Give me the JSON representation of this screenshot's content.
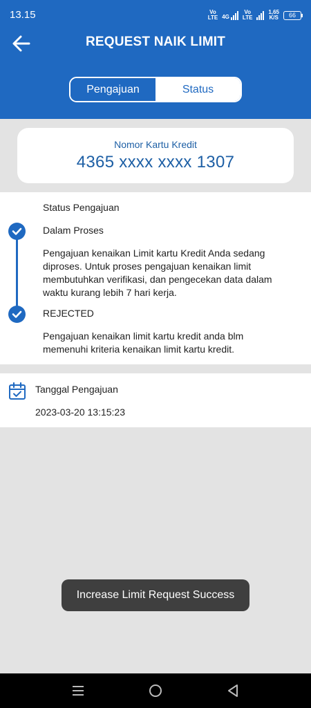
{
  "status_bar": {
    "time": "13.15",
    "vo_label": "Vo",
    "lte_label": "LTE",
    "net_4g": "4G",
    "net_speed": "1,65",
    "net_speed_unit": "K/S",
    "battery": "66"
  },
  "header": {
    "title": "REQUEST NAIK LIMIT",
    "tabs": [
      {
        "label": "Pengajuan",
        "active": false
      },
      {
        "label": "Status",
        "active": true
      }
    ]
  },
  "card": {
    "label": "Nomor Kartu Kredit",
    "number": "4365 xxxx xxxx 1307"
  },
  "status": {
    "heading": "Status Pengajuan",
    "steps": [
      {
        "title": "Dalam Proses",
        "description": "Pengajuan kenaikan Limit kartu Kredit Anda sedang diproses. Untuk proses pengajuan kenaikan limit membutuhkan verifikasi, dan pengecekan data dalam waktu kurang lebih 7 hari kerja."
      },
      {
        "title": "REJECTED",
        "description": "Pengajuan kenaikan limit kartu kredit anda blm memenuhi kriteria kenaikan limit kartu kredit."
      }
    ]
  },
  "submission": {
    "label": "Tanggal Pengajuan",
    "date": "2023-03-20 13:15:23"
  },
  "toast": {
    "message": "Increase Limit Request Success"
  },
  "colors": {
    "primary": "#1f69c1",
    "background": "#e3e3e3",
    "toast_bg": "#3f3f3f"
  },
  "icons": {
    "back": "arrow-left-icon",
    "step": "check-circle-icon",
    "date": "calendar-check-icon",
    "nav_menu": "menu-icon",
    "nav_home": "home-circle-icon",
    "nav_back": "triangle-back-icon"
  }
}
